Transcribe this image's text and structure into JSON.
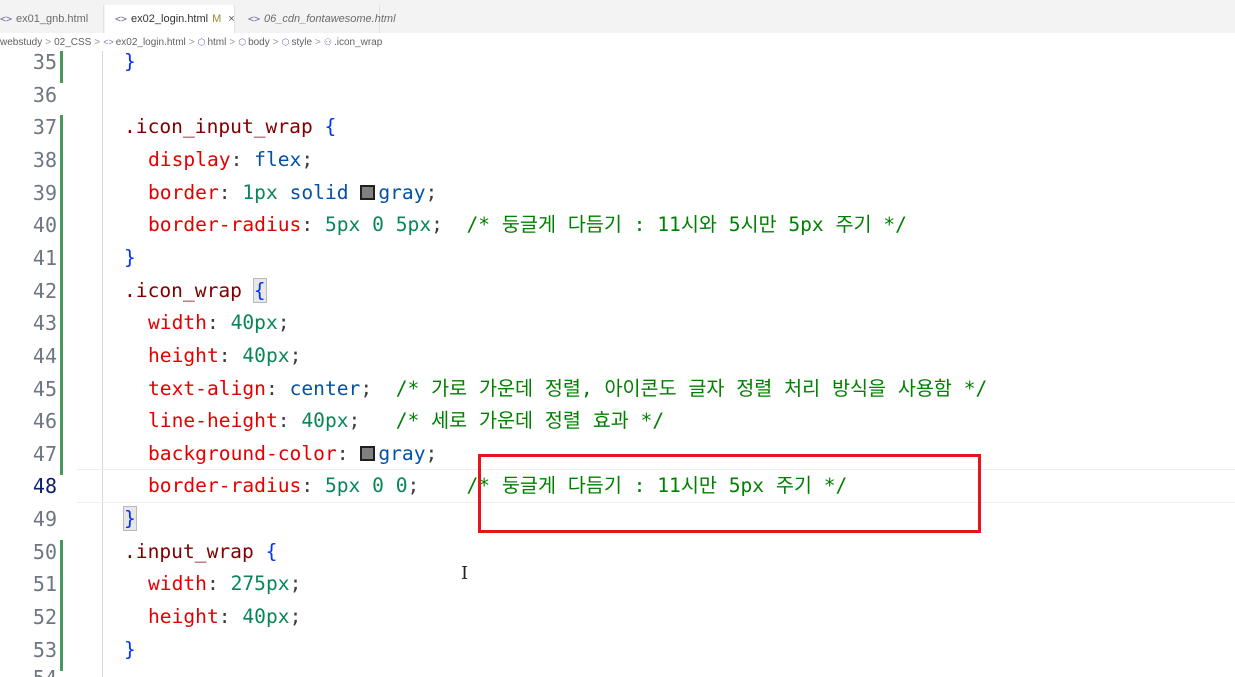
{
  "tabs": [
    {
      "icon": "<>",
      "label": "ex01_gnb.html"
    },
    {
      "icon": "<>",
      "label": "ex02_login.html",
      "modified": "M",
      "close": "×"
    },
    {
      "icon": "<>",
      "label": "06_cdn_fontawesome.html"
    }
  ],
  "breadcrumb": {
    "items": [
      "webstudy",
      "02_CSS",
      "ex02_login.html",
      "html",
      "body",
      "style",
      ".icon_wrap"
    ],
    "separator": ">"
  },
  "editor": {
    "lines": [
      {
        "n": "35",
        "parts": [
          {
            "t": "}",
            "c": "brace"
          }
        ],
        "indent": 1
      },
      {
        "n": "36",
        "parts": [],
        "indent": 0
      },
      {
        "n": "37",
        "parts": [
          {
            "t": ".icon_input_wrap ",
            "c": "sel"
          },
          {
            "t": "{",
            "c": "brace"
          }
        ],
        "indent": 1
      },
      {
        "n": "38",
        "parts": [
          {
            "t": "display",
            "c": "prop"
          },
          {
            "t": ": ",
            "c": "punc"
          },
          {
            "t": "flex",
            "c": "val"
          },
          {
            "t": ";",
            "c": "punc"
          }
        ],
        "indent": 2
      },
      {
        "n": "39",
        "parts": [
          {
            "t": "border",
            "c": "prop"
          },
          {
            "t": ": ",
            "c": "punc"
          },
          {
            "t": "1px",
            "c": "num"
          },
          {
            "t": " ",
            "c": "punc"
          },
          {
            "t": "solid",
            "c": "val"
          },
          {
            "t": " ",
            "c": "punc"
          },
          {
            "swatch": "#808080"
          },
          {
            "t": "gray",
            "c": "val"
          },
          {
            "t": ";",
            "c": "punc"
          }
        ],
        "indent": 2
      },
      {
        "n": "40",
        "parts": [
          {
            "t": "border-radius",
            "c": "prop"
          },
          {
            "t": ": ",
            "c": "punc"
          },
          {
            "t": "5px 0 5px",
            "c": "num"
          },
          {
            "t": ";  ",
            "c": "punc"
          },
          {
            "t": "/* 둥글게 다듬기 : 11시와 5시만 5px 주기 */",
            "c": "cmt"
          }
        ],
        "indent": 2
      },
      {
        "n": "41",
        "parts": [
          {
            "t": "}",
            "c": "brace"
          }
        ],
        "indent": 1
      },
      {
        "n": "42",
        "parts": [
          {
            "t": ".icon_wrap ",
            "c": "sel"
          },
          {
            "t": "{",
            "c": "brace-hl"
          }
        ],
        "indent": 1
      },
      {
        "n": "43",
        "parts": [
          {
            "t": "width",
            "c": "prop"
          },
          {
            "t": ": ",
            "c": "punc"
          },
          {
            "t": "40px",
            "c": "num"
          },
          {
            "t": ";",
            "c": "punc"
          }
        ],
        "indent": 2
      },
      {
        "n": "44",
        "parts": [
          {
            "t": "height",
            "c": "prop"
          },
          {
            "t": ": ",
            "c": "punc"
          },
          {
            "t": "40px",
            "c": "num"
          },
          {
            "t": ";",
            "c": "punc"
          }
        ],
        "indent": 2
      },
      {
        "n": "45",
        "parts": [
          {
            "t": "text-align",
            "c": "prop"
          },
          {
            "t": ": ",
            "c": "punc"
          },
          {
            "t": "center",
            "c": "val"
          },
          {
            "t": ";  ",
            "c": "punc"
          },
          {
            "t": "/* 가로 가운데 정렬, 아이콘도 글자 정렬 처리 방식을 사용함 */",
            "c": "cmt"
          }
        ],
        "indent": 2
      },
      {
        "n": "46",
        "parts": [
          {
            "t": "line-height",
            "c": "prop"
          },
          {
            "t": ": ",
            "c": "punc"
          },
          {
            "t": "40px",
            "c": "num"
          },
          {
            "t": ";   ",
            "c": "punc"
          },
          {
            "t": "/* 세로 가운데 정렬 효과 */",
            "c": "cmt"
          }
        ],
        "indent": 2
      },
      {
        "n": "47",
        "parts": [
          {
            "t": "background-color",
            "c": "prop"
          },
          {
            "t": ": ",
            "c": "punc"
          },
          {
            "swatch": "#808080"
          },
          {
            "t": "gray",
            "c": "val"
          },
          {
            "t": ";",
            "c": "punc"
          }
        ],
        "indent": 2
      },
      {
        "n": "48",
        "parts": [
          {
            "t": "border-radius",
            "c": "prop"
          },
          {
            "t": ": ",
            "c": "punc"
          },
          {
            "t": "5px 0 0",
            "c": "num"
          },
          {
            "t": ";    ",
            "c": "punc"
          },
          {
            "t": "/* 둥글게 다듬기 : 11시만 5px 주기 */",
            "c": "cmt"
          }
        ],
        "indent": 2,
        "current": true
      },
      {
        "n": "49",
        "parts": [
          {
            "t": "}",
            "c": "brace-hl"
          }
        ],
        "indent": 1
      },
      {
        "n": "50",
        "parts": [
          {
            "t": ".input_wrap ",
            "c": "sel"
          },
          {
            "t": "{",
            "c": "brace"
          }
        ],
        "indent": 1
      },
      {
        "n": "51",
        "parts": [
          {
            "t": "width",
            "c": "prop"
          },
          {
            "t": ": ",
            "c": "punc"
          },
          {
            "t": "275px",
            "c": "num"
          },
          {
            "t": ";",
            "c": "punc"
          }
        ],
        "indent": 2
      },
      {
        "n": "52",
        "parts": [
          {
            "t": "height",
            "c": "prop"
          },
          {
            "t": ": ",
            "c": "punc"
          },
          {
            "t": "40px",
            "c": "num"
          },
          {
            "t": ";",
            "c": "punc"
          }
        ],
        "indent": 2
      },
      {
        "n": "53",
        "parts": [
          {
            "t": "}",
            "c": "brace"
          }
        ],
        "indent": 1
      }
    ],
    "partial_line_number": "54",
    "colors": {
      "selector": "#800000",
      "property": "#e50000",
      "number": "#098658",
      "value": "#0451a5",
      "comment": "#008000",
      "brace": "#0431fa",
      "gutter_modified": "#48985d",
      "annotation_box": "#e8141d"
    }
  },
  "cursor_icon": "text-cursor-icon"
}
